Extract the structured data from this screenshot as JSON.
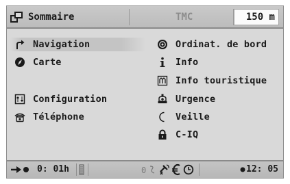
{
  "header": {
    "title": "Sommaire",
    "tmc": "TMC",
    "distance": "150 m"
  },
  "menu": {
    "left": [
      {
        "label": "Navigation",
        "icon": "navigation-turn-icon",
        "selected": true
      },
      {
        "label": "Carte",
        "icon": "map-compass-icon"
      },
      {
        "label": "Configuration",
        "icon": "configuration-icon"
      },
      {
        "label": "Téléphone",
        "icon": "telephone-icon"
      }
    ],
    "right": [
      {
        "label": "Ordinat. de bord",
        "icon": "trip-computer-icon"
      },
      {
        "label": "Info",
        "icon": "info-icon"
      },
      {
        "label": "Info touristique",
        "icon": "tourist-info-icon"
      },
      {
        "label": "Urgence",
        "icon": "emergency-icon"
      },
      {
        "label": "Veille",
        "icon": "standby-moon-icon"
      },
      {
        "label": "C-IQ",
        "icon": "padlock-icon"
      }
    ]
  },
  "status": {
    "eta": "0: 01h",
    "zero": "0",
    "time": "12: 05"
  },
  "colors": {
    "screen_bg": "#d9d9d9",
    "bar_bg": "#bcbcbc",
    "text": "#1a1a1a",
    "muted": "#8c8c8c"
  }
}
